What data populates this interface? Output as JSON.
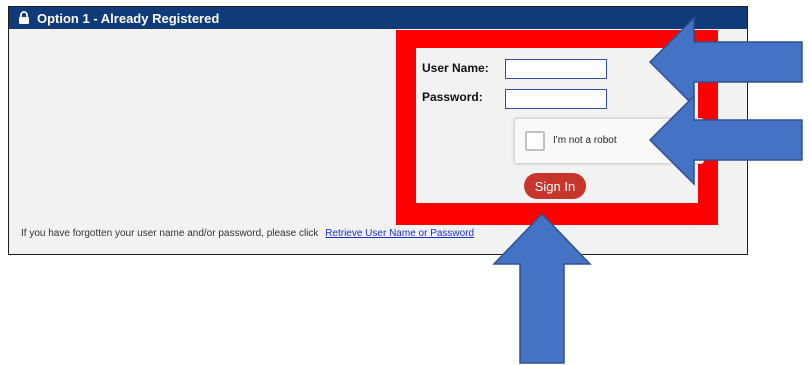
{
  "panel": {
    "title": "Option 1 - Already Registered",
    "lock_icon": "lock-icon"
  },
  "form": {
    "username_label": "User Name:",
    "password_label": "Password:",
    "username_value": "",
    "password_value": "",
    "captcha_label": "I'm not a robot",
    "signin_label": "Sign In"
  },
  "footer": {
    "text": "If you have forgotten your user name and/or password, please click",
    "link": "Retrieve User Name or Password"
  },
  "colors": {
    "header": "#0f3c78",
    "highlight_frame": "#ff0000",
    "signin": "#c7362b",
    "arrow_fill": "#4472c4",
    "arrow_stroke": "#2f528f"
  }
}
